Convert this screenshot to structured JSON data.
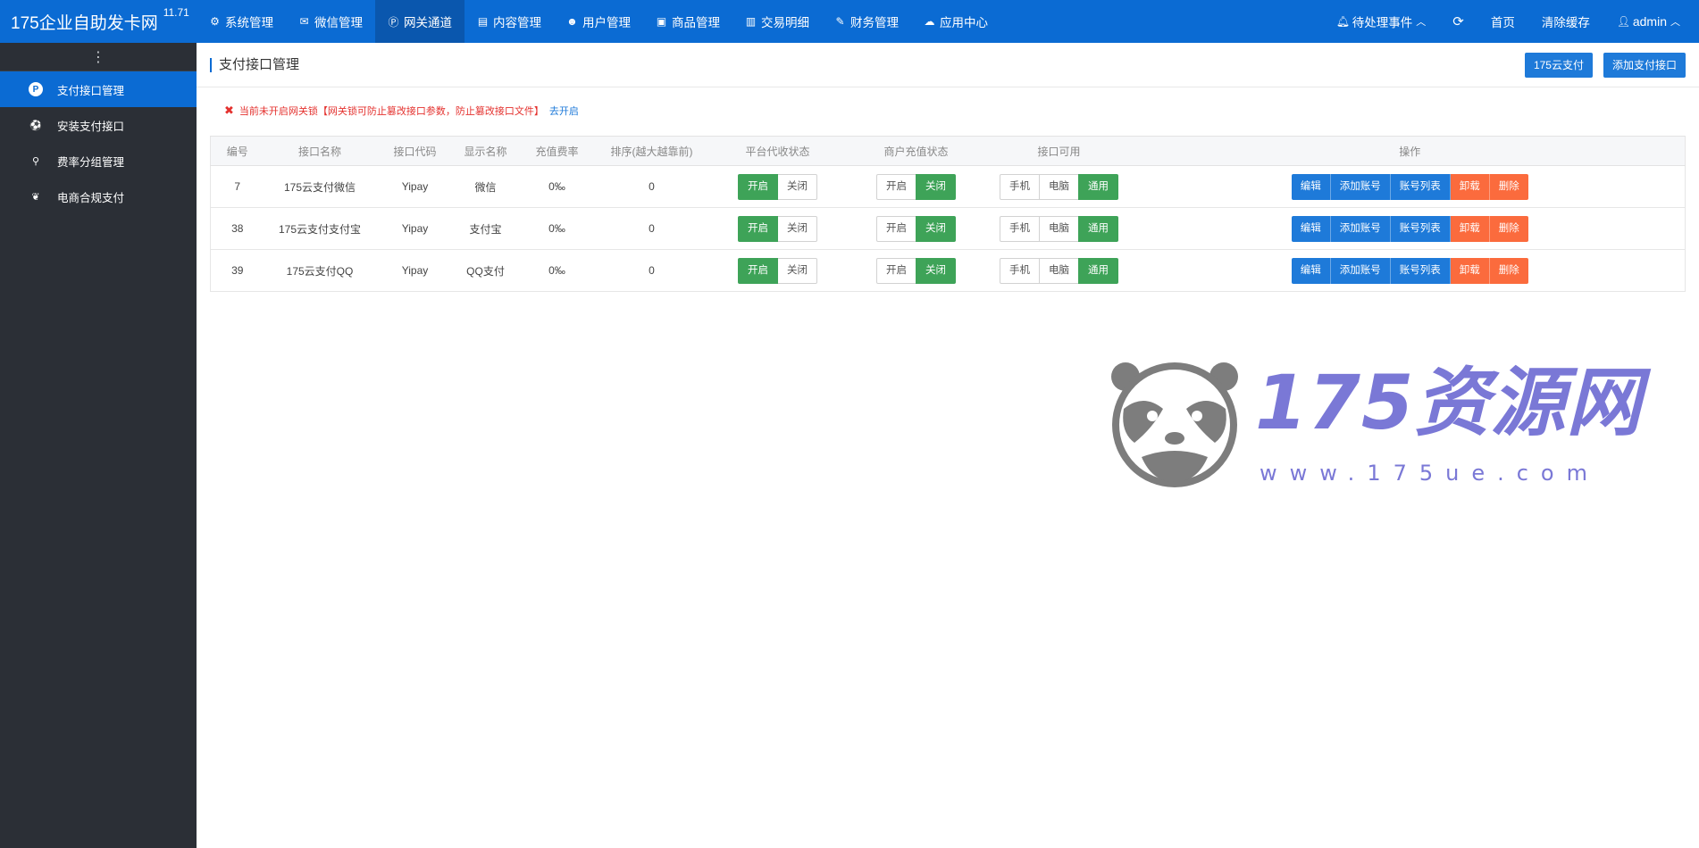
{
  "app": {
    "title": "175企业自助发卡网",
    "version": "11.71"
  },
  "nav": [
    {
      "label": "系统管理",
      "icon": "gear-icon",
      "glyph": "⚙"
    },
    {
      "label": "微信管理",
      "icon": "wechat-icon",
      "glyph": "✉"
    },
    {
      "label": "网关通道",
      "icon": "p-circle-icon",
      "glyph": "Ⓟ",
      "active": true
    },
    {
      "label": "内容管理",
      "icon": "file-icon",
      "glyph": "▤"
    },
    {
      "label": "用户管理",
      "icon": "users-icon",
      "glyph": "☻"
    },
    {
      "label": "商品管理",
      "icon": "bag-icon",
      "glyph": "▣"
    },
    {
      "label": "交易明细",
      "icon": "chart-icon",
      "glyph": "▥"
    },
    {
      "label": "财务管理",
      "icon": "money-icon",
      "glyph": "✎"
    },
    {
      "label": "应用中心",
      "icon": "cloud-icon",
      "glyph": "☁"
    }
  ],
  "nav_right": {
    "events": "待处理事件",
    "refresh_glyph": "⟳",
    "home": "首页",
    "clear_cache": "清除缓存",
    "user": "admin"
  },
  "sidebar": {
    "toggle_glyph": "⋮",
    "items": [
      {
        "label": "支付接口管理",
        "icon": "p-circle-icon",
        "glyph": "P",
        "active": true
      },
      {
        "label": "安装支付接口",
        "icon": "ball-icon",
        "glyph": "⚽"
      },
      {
        "label": "费率分组管理",
        "icon": "link-icon",
        "glyph": "⚲"
      },
      {
        "label": "电商合规支付",
        "icon": "leaf-icon",
        "glyph": "❦"
      }
    ]
  },
  "page": {
    "title": "支付接口管理",
    "btn_cloud": "175云支付",
    "btn_add": "添加支付接口",
    "warning": "当前未开启网关锁【网关锁可防止篡改接口参数，防止篡改接口文件】",
    "warning_link": "去开启",
    "warning_glyph": "✖"
  },
  "table": {
    "headers": [
      "编号",
      "接口名称",
      "接口代码",
      "显示名称",
      "充值费率",
      "排序(越大越靠前)",
      "平台代收状态",
      "商户充值状态",
      "接口可用",
      "操作"
    ],
    "labels": {
      "on": "开启",
      "off": "关闭",
      "mobile": "手机",
      "pc": "电脑",
      "all": "通用",
      "edit": "编辑",
      "add_account": "添加账号",
      "account_list": "账号列表",
      "uninstall": "卸载",
      "delete": "删除"
    },
    "rows": [
      {
        "id": "7",
        "name": "175云支付微信",
        "code": "Yipay",
        "display": "微信",
        "rate": "0‰",
        "sort": "0"
      },
      {
        "id": "38",
        "name": "175云支付支付宝",
        "code": "Yipay",
        "display": "支付宝",
        "rate": "0‰",
        "sort": "0"
      },
      {
        "id": "39",
        "name": "175云支付QQ",
        "code": "Yipay",
        "display": "QQ支付",
        "rate": "0‰",
        "sort": "0"
      }
    ]
  },
  "watermark": {
    "text": "175资源网",
    "url": "www.175ue.com"
  },
  "colors": {
    "primary": "#0b6bd3",
    "green": "#3ea358",
    "orange": "#fb6b3d",
    "sidebar": "#2b2f36",
    "danger": "#e4312e",
    "watermark": "#7a78d6"
  }
}
